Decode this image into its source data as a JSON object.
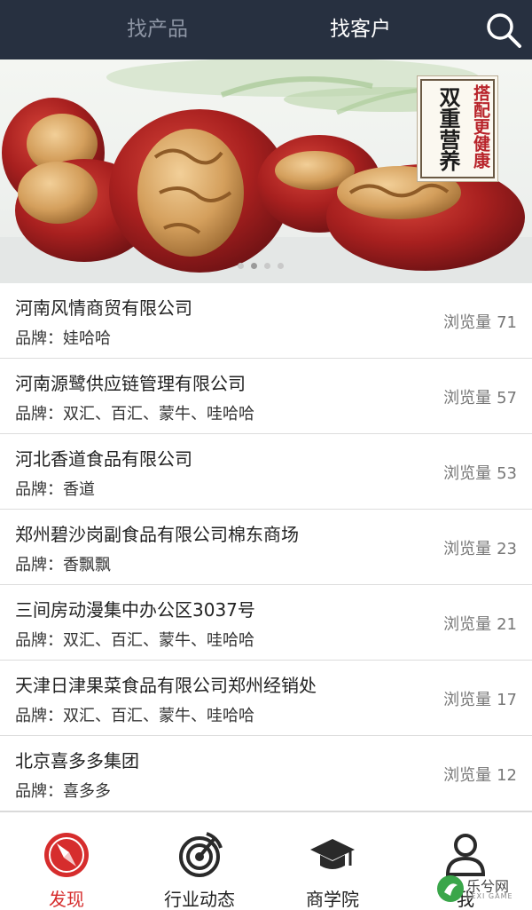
{
  "header": {
    "tabs": [
      {
        "label": "找产品",
        "active": false
      },
      {
        "label": "找客户",
        "active": true
      }
    ],
    "search_icon": "search-icon"
  },
  "banner": {
    "promo_main": "双重营养",
    "promo_sub": "搭配更健康",
    "slide_count": 4,
    "active_slide": 1
  },
  "list": {
    "brand_prefix": "品牌：",
    "views_label": "浏览量",
    "items": [
      {
        "name": "河南风情商贸有限公司",
        "brand": "娃哈哈",
        "views": "71"
      },
      {
        "name": "河南源鹭供应链管理有限公司",
        "brand": "双汇、百汇、蒙牛、哇哈哈",
        "views": "57"
      },
      {
        "name": "河北香道食品有限公司",
        "brand": "香道",
        "views": "53"
      },
      {
        "name": "郑州碧沙岗副食品有限公司棉东商场",
        "brand": "香飘飘",
        "views": "23"
      },
      {
        "name": "三间房动漫集中办公区3037号",
        "brand": "双汇、百汇、蒙牛、哇哈哈",
        "views": "21"
      },
      {
        "name": "天津日津果菜食品有限公司郑州经销处",
        "brand": "双汇、百汇、蒙牛、哇哈哈",
        "views": "17"
      },
      {
        "name": "北京喜多多集团",
        "brand": "喜多多",
        "views": "12"
      }
    ]
  },
  "bottom_nav": {
    "items": [
      {
        "label": "发现",
        "icon": "compass-icon",
        "active": true
      },
      {
        "label": "行业动态",
        "icon": "radar-icon",
        "active": false
      },
      {
        "label": "商学院",
        "icon": "graduation-cap-icon",
        "active": false
      },
      {
        "label": "我",
        "icon": "user-icon",
        "active": false
      }
    ]
  },
  "watermark": {
    "text": "乐兮网",
    "sub": "LEXI GAME"
  },
  "colors": {
    "header_bg": "#273040",
    "active_red": "#d62d2d",
    "inactive_tab": "#8d95a4"
  }
}
